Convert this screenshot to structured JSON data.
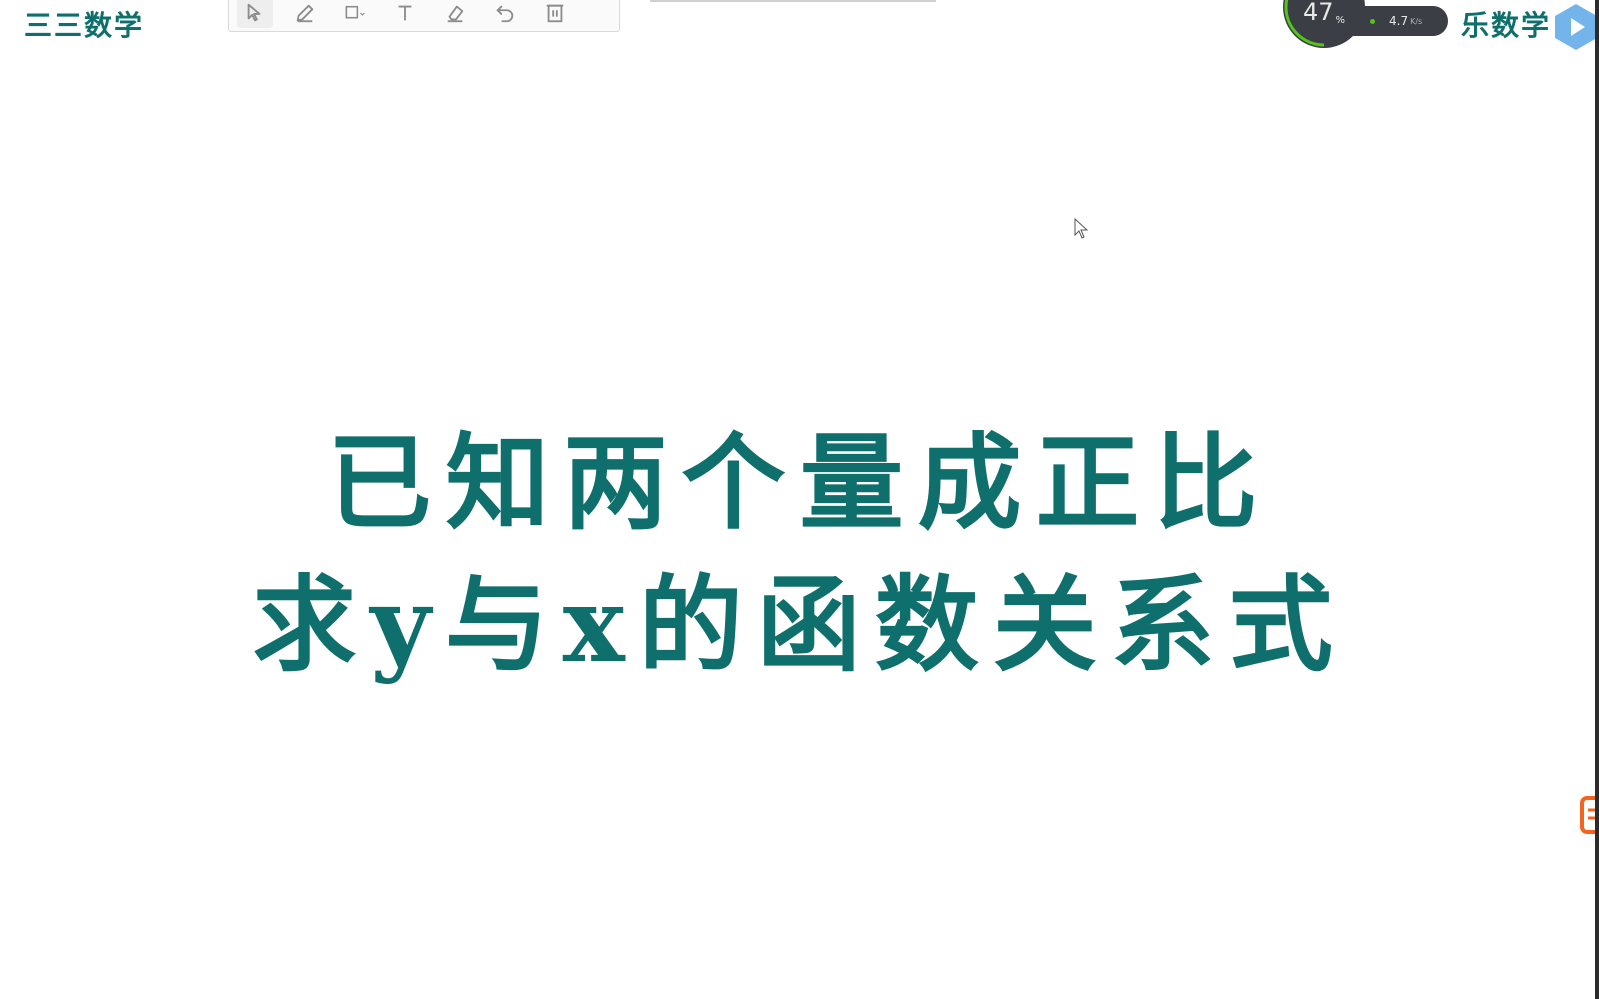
{
  "header": {
    "brand_left": "三三数学",
    "brand_right": "乐数学"
  },
  "toolbar": {
    "tools": [
      {
        "name": "select",
        "icon": "cursor-arrow-icon",
        "active": true
      },
      {
        "name": "pen",
        "icon": "pencil-icon",
        "active": false
      },
      {
        "name": "shape",
        "icon": "square-icon",
        "active": false
      },
      {
        "name": "text",
        "icon": "text-icon",
        "active": false
      },
      {
        "name": "eraser",
        "icon": "eraser-icon",
        "active": false
      },
      {
        "name": "undo",
        "icon": "undo-icon",
        "active": false
      },
      {
        "name": "delete",
        "icon": "trash-icon",
        "active": false
      }
    ]
  },
  "overlay": {
    "gauge_value": "47",
    "gauge_unit": "%",
    "gauge_fraction": 0.47,
    "speed_value": "4.7",
    "speed_unit": "K/s"
  },
  "slide": {
    "line1": "已知两个量成正比",
    "line2": "求y与x的函数关系式"
  },
  "colors": {
    "title_teal": "#0f6f6c",
    "toolbar_icon": "#8c8c8c",
    "overlay_dark": "#3b3f45",
    "gauge_accent": "#52c41a",
    "badge_orange": "#f5641e"
  }
}
